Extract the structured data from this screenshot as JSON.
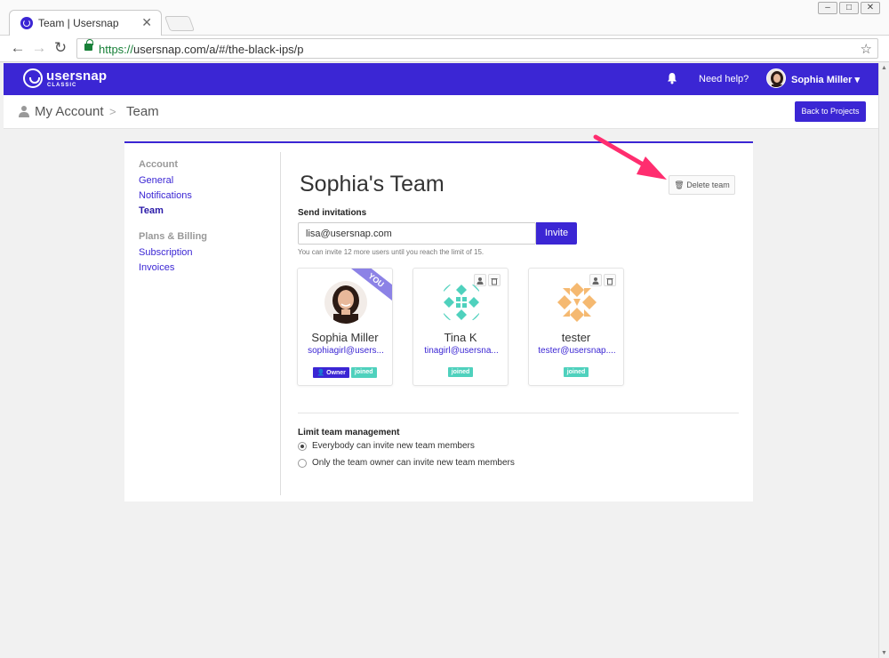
{
  "browser": {
    "tab_title": "Team | Usersnap",
    "url_scheme": "https://",
    "url_rest": "usersnap.com/a/#/the-black-ips/p"
  },
  "header": {
    "logo_text": "usersnap",
    "logo_sub": "CLASSIC",
    "need_help": "Need help?",
    "user_name": "Sophia Miller",
    "brand_color": "#3b26d4"
  },
  "breadcrumb": {
    "items": [
      "My Account",
      "Team"
    ],
    "separator": ">",
    "back_button": "Back to Projects"
  },
  "sidebar": {
    "account_heading": "Account",
    "account_links": [
      "General",
      "Notifications",
      "Team"
    ],
    "billing_heading": "Plans & Billing",
    "billing_links": [
      "Subscription",
      "Invoices"
    ]
  },
  "team": {
    "title": "Sophia's Team",
    "delete_button": "Delete team",
    "send_invitations_label": "Send invitations",
    "invite_value": "lisa@usersnap.com",
    "invite_button": "Invite",
    "invite_hint": "You can invite 12 more users until you reach the limit of 15.",
    "members": [
      {
        "name": "Sophia Miller",
        "email": "sophiagirl@users...",
        "badges": [
          "Owner",
          "joined"
        ],
        "ribbon": "YOU"
      },
      {
        "name": "Tina K",
        "email": "tinagirl@usersna...",
        "badges": [
          "joined"
        ]
      },
      {
        "name": "tester",
        "email": "tester@usersnap....",
        "badges": [
          "joined"
        ]
      }
    ],
    "limit_heading": "Limit team management",
    "limit_options": [
      {
        "label": "Everybody can invite new team members",
        "checked": true
      },
      {
        "label": "Only the team owner can invite new team members",
        "checked": false
      }
    ]
  }
}
